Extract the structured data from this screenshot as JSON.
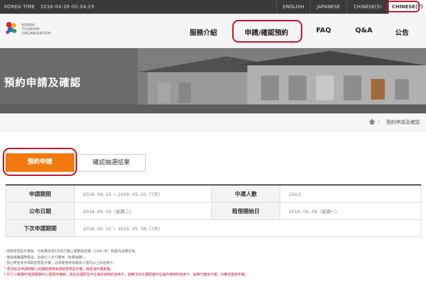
{
  "topbar": {
    "time_label": "KOREA TIME",
    "time_value": "2016-04-26 00:34:19",
    "languages": [
      "ENGLISH",
      "JAPANESE",
      "CHINESE(S)",
      "CHINESE(T)"
    ]
  },
  "header": {
    "logo_lines": [
      "KOREA",
      "TOURISM",
      "ORGANIZATION"
    ],
    "nav": [
      "服務介紹",
      "申請/確認預約",
      "FAQ",
      "Q&A",
      "公告"
    ]
  },
  "hero": {
    "title": "預約申請及確認"
  },
  "breadcrumb": {
    "current": "預約申請及確認"
  },
  "tabs": {
    "active": "預約申請",
    "other": "確認抽選結果"
  },
  "table": {
    "rows": [
      [
        {
          "h": "申請期間"
        },
        {
          "v": "2016. 04. 25 ~ 2016. 05. 01（7天）"
        },
        {
          "h": "中選人數"
        },
        {
          "v": "250人"
        }
      ],
      [
        {
          "h": "公布日期"
        },
        {
          "v": "2016. 05. 03（星期二）"
        },
        {
          "h": "租借開始日"
        },
        {
          "v": "2016. 05. 09（星期一）"
        }
      ],
      [
        {
          "h": "下次申請期間"
        },
        {
          "v": "2016. 05. 02 ~ 2016. 05. 08（7天）"
        }
      ]
    ]
  },
  "notes": {
    "gray": [
      "- 領取智慧型手機後，可免費享受5天的行動上網數據流量（1GB /日）和國內話費全免。",
      "- 僅能接聽國際電話，由撥打人支付費用（免費接聽）。",
      "- 預訂押金後可領取智慧型手機，必須使用有效期高三個月以上的信用卡。"
    ],
    "red": [
      "* 若沒有在申請時輸入的期間使用目領取智慧型手機，將取消中選資格。",
      "* 於仁川機場KT租賃服務中心租借手機時，需出示護照及可在海外使用的信用卡。如無法出示護照或可在海外使用的信用卡，就算已確定中選，亦無法租借手機。"
    ]
  },
  "colors": {
    "accent": "#f2790f",
    "highlight": "#c8102e",
    "topbar": "#3a3a3a"
  }
}
